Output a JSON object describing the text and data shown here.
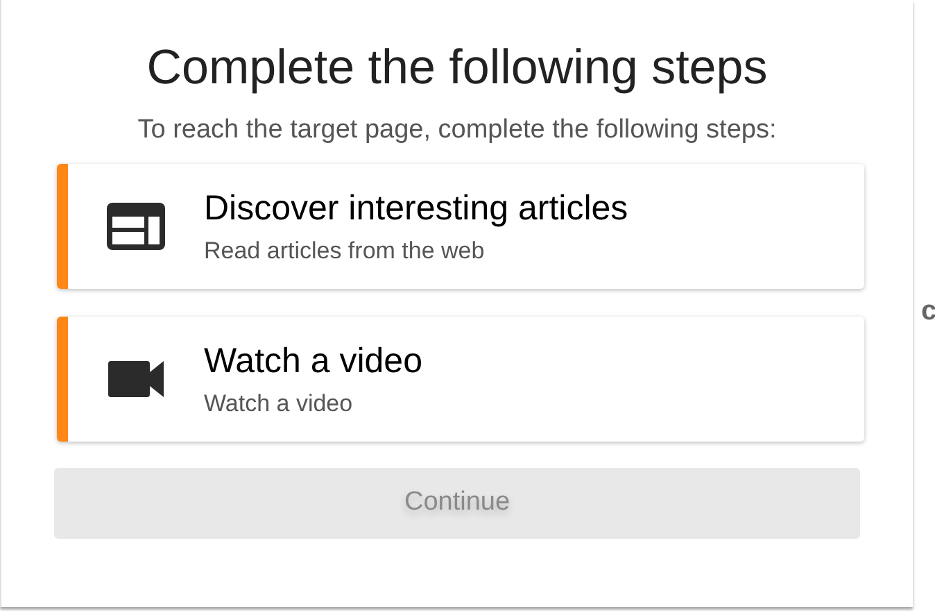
{
  "title": "Complete the following steps",
  "subtitle": "To reach the target page, complete the following steps:",
  "steps": [
    {
      "kind": "articles",
      "title": "Discover interesting articles",
      "description": "Read articles from the web"
    },
    {
      "kind": "video",
      "title": "Watch a video",
      "description": "Watch a video"
    }
  ],
  "continue_button": {
    "label": "Continue",
    "disabled": true
  },
  "edge_text": "c"
}
